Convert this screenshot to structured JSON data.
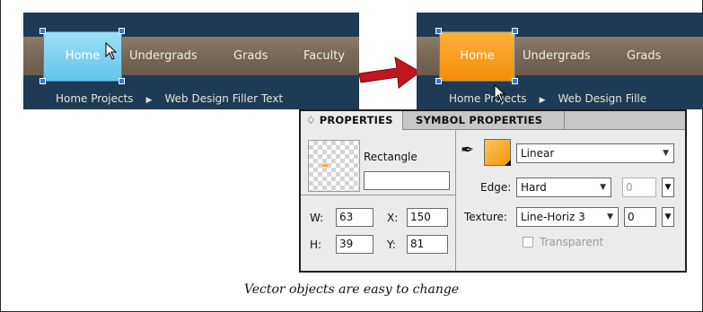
{
  "nav_before": {
    "items": [
      "Home",
      "Undergrads",
      "Grads",
      "Faculty"
    ],
    "subnav": [
      "Home Projects",
      "Web Design Filler Text"
    ],
    "home_color": "#6cc8ec"
  },
  "nav_after": {
    "items": [
      "Home",
      "Undergrads",
      "Grads"
    ],
    "subnav": [
      "Home Projects",
      "Web Design Fille"
    ],
    "home_color": "#f7930f"
  },
  "panel": {
    "tabs": [
      "♢ PROPERTIES",
      "SYMBOL PROPERTIES"
    ],
    "shape_name": "Rectangle",
    "name_value": "",
    "w_label": "W:",
    "w_value": "63",
    "x_label": "X:",
    "x_value": "150",
    "h_label": "H:",
    "h_value": "39",
    "y_label": "Y:",
    "y_value": "81",
    "fill_type": "Linear",
    "edge_label": "Edge:",
    "edge_value": "Hard",
    "edge_amount": "0",
    "texture_label": "Texture:",
    "texture_value": "Line-Horiz 3",
    "texture_amount": "0",
    "transparent_label": "Transparent",
    "fill_color": "#f7930f"
  },
  "caption": "Vector objects are easy to change",
  "colors": {
    "arrow": "#c0161c",
    "nav_background": "#1f3a55",
    "selection": "#2c7bd0"
  }
}
